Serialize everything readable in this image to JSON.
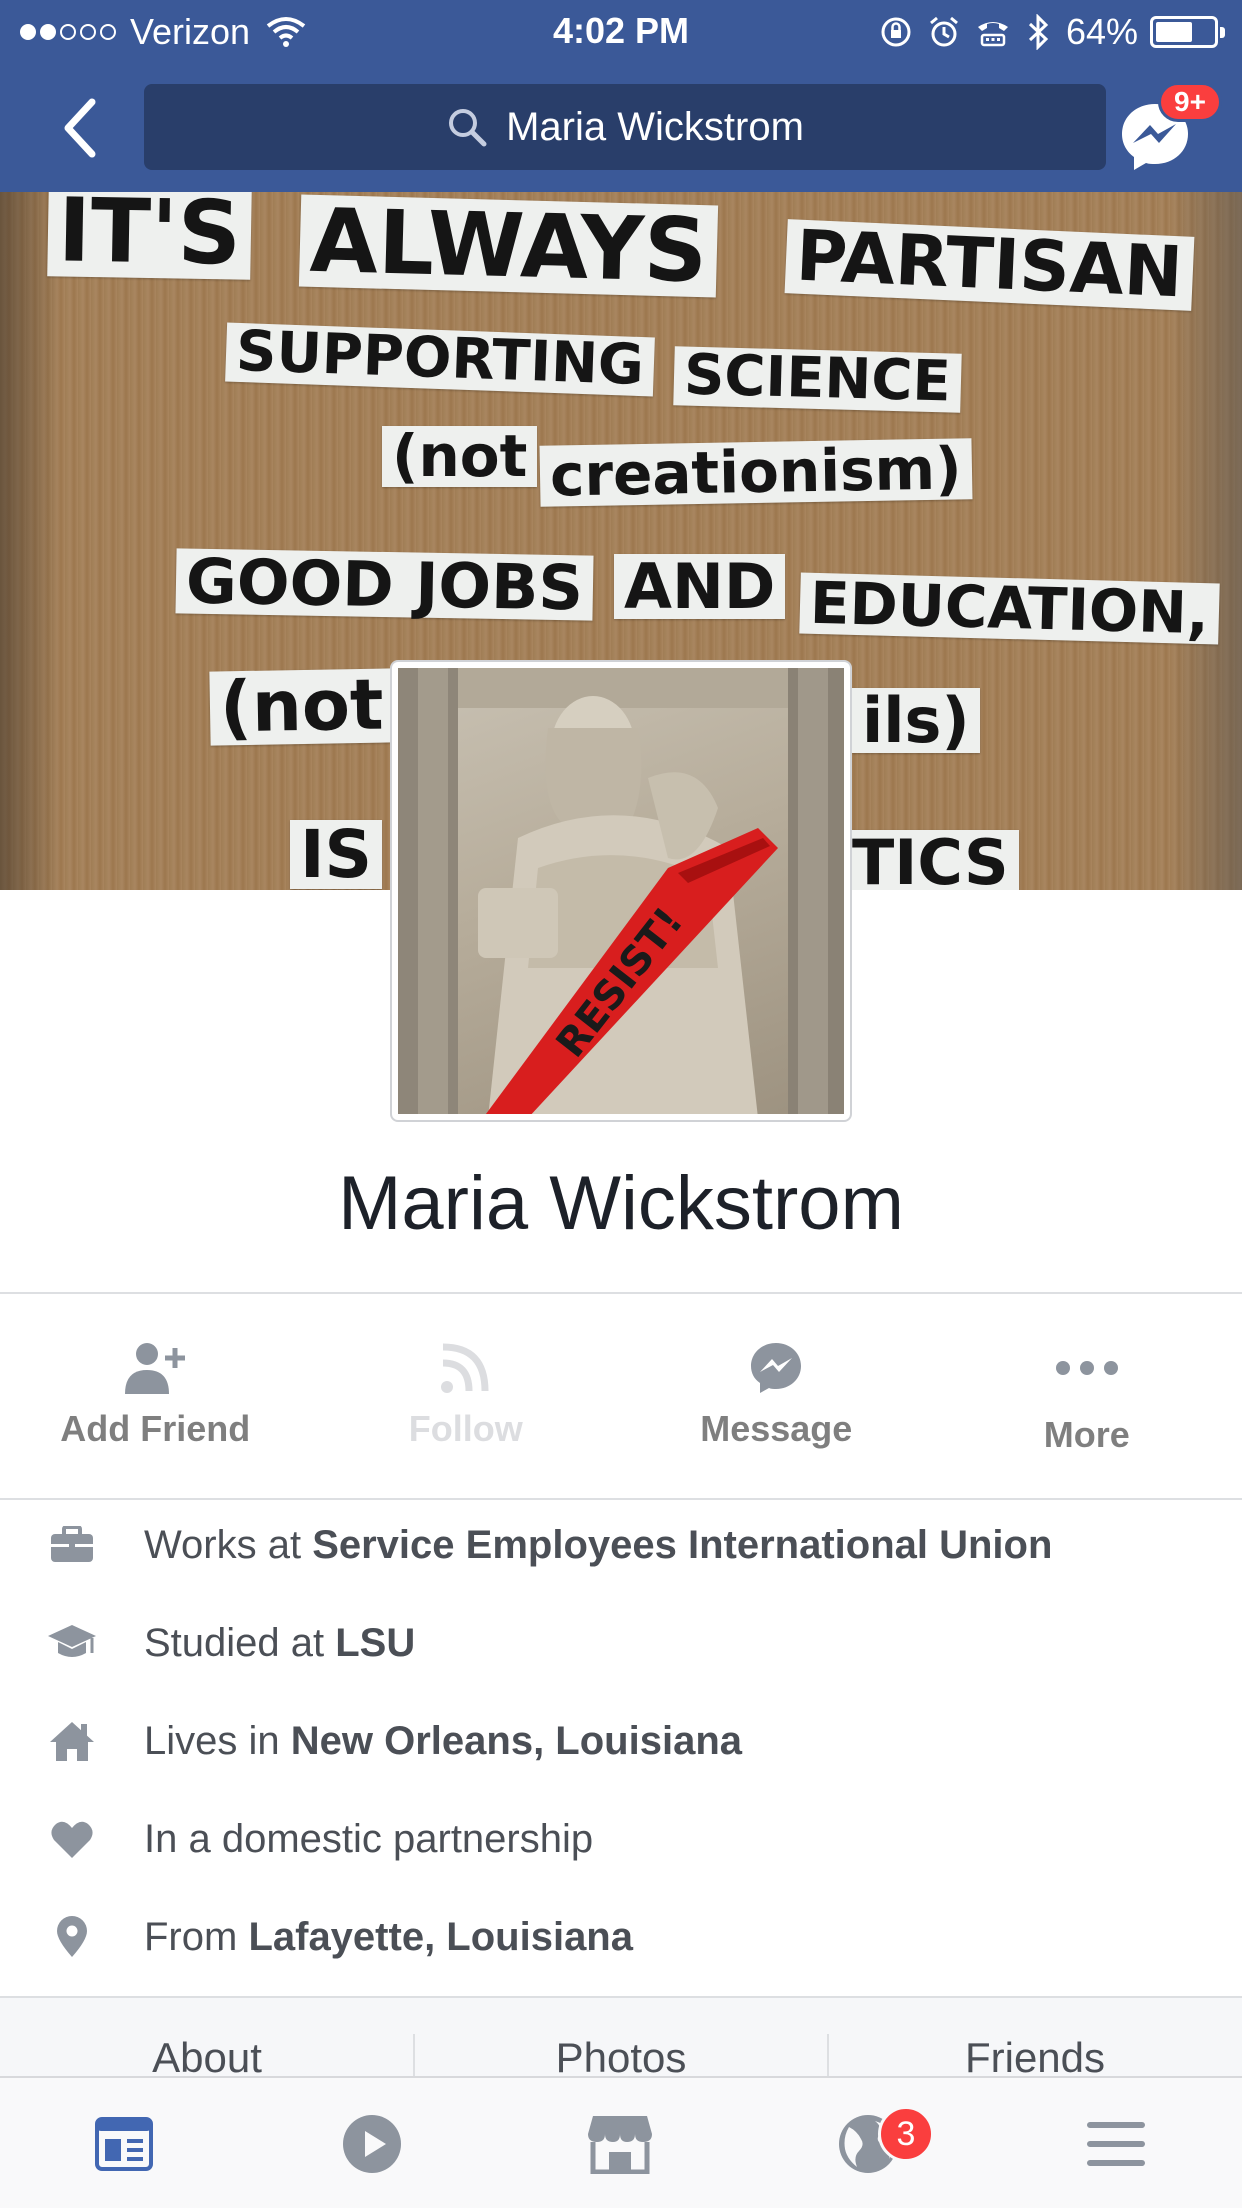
{
  "status_bar": {
    "carrier": "Verizon",
    "time": "4:02 PM",
    "battery": "64%",
    "battery_level": 0.64,
    "signal_bars_filled": 2,
    "signal_bars_total": 5,
    "icons": [
      "wifi-icon",
      "orientation-lock-icon",
      "alarm-icon",
      "tty-icon",
      "bluetooth-icon",
      "battery-icon"
    ]
  },
  "header": {
    "search_text": "Maria Wickstrom",
    "messenger_badge": "9+",
    "back_icon": "chevron-left-icon",
    "search_icon": "search-icon",
    "messenger_icon": "messenger-icon",
    "bar_color": "#3b5998"
  },
  "cover": {
    "sign_lines": [
      [
        "IT'S",
        "ALWAYS",
        "PARTISAN"
      ],
      [
        "SUPPORTING",
        "SCIENCE"
      ],
      [
        "(not",
        "creationism)"
      ],
      [
        "GOOD JOBS",
        "AND",
        "EDUCATION,"
      ],
      [
        "(not",
        "ils)"
      ],
      [
        "IS",
        "TICS"
      ]
    ]
  },
  "profile": {
    "name": "Maria Wickstrom",
    "sash_text": "RESIST!"
  },
  "actions": [
    {
      "label": "Add Friend",
      "icon": "add-friend-icon",
      "enabled": true
    },
    {
      "label": "Follow",
      "icon": "follow-rss-icon",
      "enabled": false
    },
    {
      "label": "Message",
      "icon": "messenger-icon",
      "enabled": true
    },
    {
      "label": "More",
      "icon": "more-dots-icon",
      "enabled": true
    }
  ],
  "intro": [
    {
      "icon": "briefcase-icon",
      "prefix": "Works at ",
      "value": "Service Employees International Union"
    },
    {
      "icon": "graduation-cap-icon",
      "prefix": "Studied at ",
      "value": "LSU"
    },
    {
      "icon": "home-icon",
      "prefix": "Lives in ",
      "value": "New Orleans, Louisiana"
    },
    {
      "icon": "heart-icon",
      "prefix": "In a domestic partnership",
      "value": ""
    },
    {
      "icon": "location-pin-icon",
      "prefix": "From ",
      "value": "Lafayette, Louisiana"
    }
  ],
  "tabs": [
    "About",
    "Photos",
    "Friends"
  ],
  "tabbar": {
    "items": [
      "news-feed-icon",
      "video-icon",
      "marketplace-icon",
      "notifications-globe-icon",
      "menu-icon"
    ],
    "notifications_badge": "3",
    "active_color": "#4267b2"
  }
}
